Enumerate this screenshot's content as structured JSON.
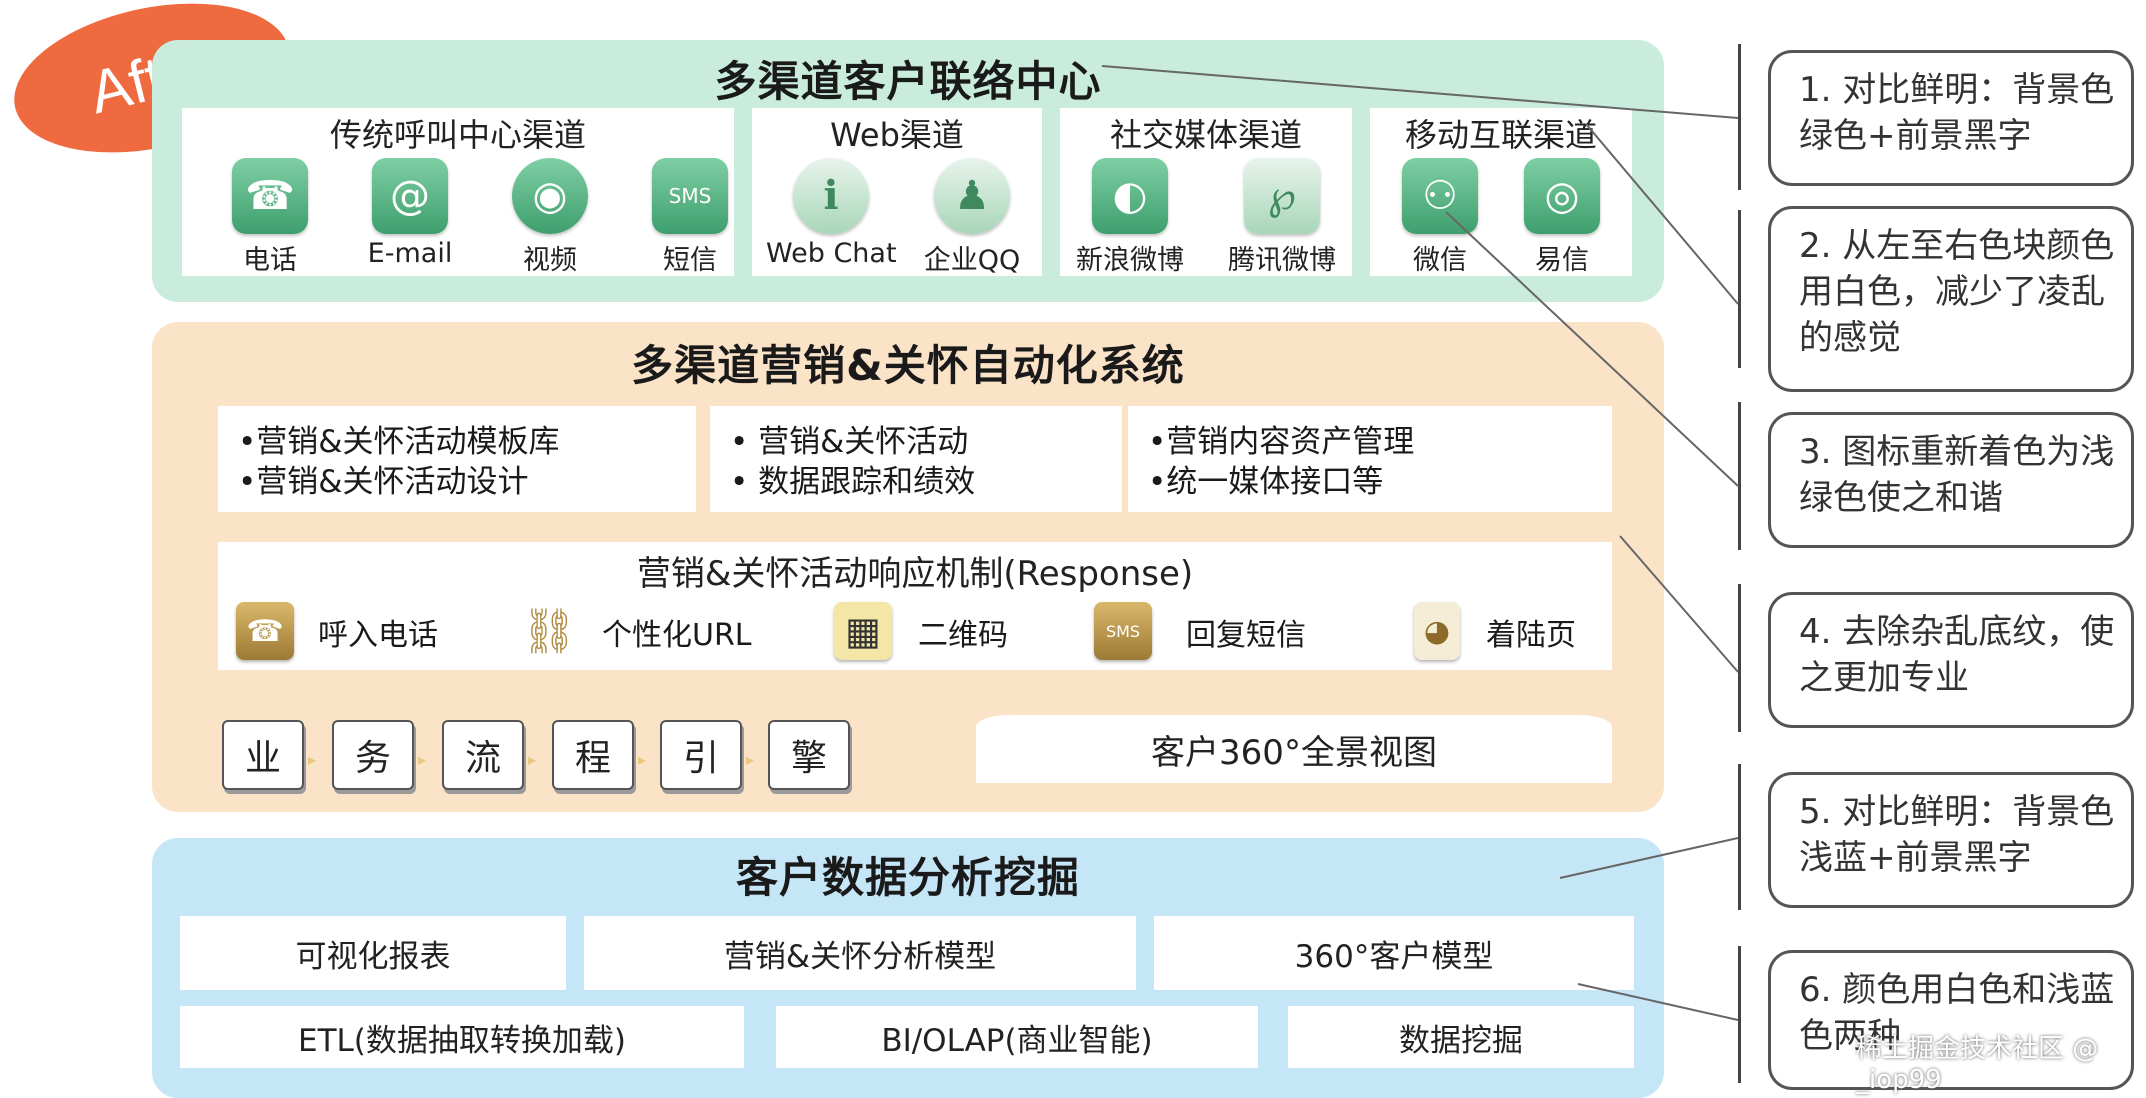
{
  "badge": "After",
  "top": {
    "title": "多渠道客户联络中心",
    "groups": [
      {
        "title": "传统呼叫中心渠道",
        "items": [
          {
            "label": "电话",
            "icon": "phone-icon"
          },
          {
            "label": "E-mail",
            "icon": "email-icon"
          },
          {
            "label": "视频",
            "icon": "webcam-icon"
          },
          {
            "label": "短信",
            "icon": "sms-icon"
          }
        ]
      },
      {
        "title": "Web渠道",
        "items": [
          {
            "label": "Web Chat",
            "icon": "chat-bubble-icon"
          },
          {
            "label": "企业QQ",
            "icon": "qq-icon"
          }
        ]
      },
      {
        "title": "社交媒体渠道",
        "items": [
          {
            "label": "新浪微博",
            "icon": "weibo-icon"
          },
          {
            "label": "腾讯微博",
            "icon": "tencent-weibo-icon"
          }
        ]
      },
      {
        "title": "移动互联渠道",
        "items": [
          {
            "label": "微信",
            "icon": "wechat-icon"
          },
          {
            "label": "易信",
            "icon": "yixin-icon"
          }
        ]
      }
    ]
  },
  "middle": {
    "title": "多渠道营销&关怀自动化系统",
    "boxes": [
      {
        "lines": [
          "•营销&关怀活动模板库",
          "•营销&关怀活动设计"
        ]
      },
      {
        "lines": [
          "•   营销&关怀活动",
          "•   数据跟踪和绩效"
        ]
      },
      {
        "lines": [
          "•营销内容资产管理",
          "•统一媒体接口等"
        ]
      }
    ],
    "response": {
      "title": "营销&关怀活动响应机制(Response)",
      "items": [
        {
          "label": "呼入电话",
          "icon": "phone-icon"
        },
        {
          "label": "个性化URL",
          "icon": "link-icon"
        },
        {
          "label": "二维码",
          "icon": "qr-code-icon"
        },
        {
          "label": "回复短信",
          "icon": "sms-icon"
        },
        {
          "label": "着陆页",
          "icon": "landing-page-icon"
        }
      ]
    },
    "engine_keys": [
      "业",
      "务",
      "流",
      "程",
      "引",
      "擎"
    ],
    "view": "客户360°全景视图"
  },
  "bottom": {
    "title": "客户数据分析挖掘",
    "row1": [
      "可视化报表",
      "营销&关怀分析模型",
      "360°客户模型"
    ],
    "row2": [
      "ETL(数据抽取转换加载)",
      "BI/OLAP(商业智能)",
      "数据挖掘"
    ]
  },
  "notes": [
    "1. 对比鲜明：背景色绿色+前景黑字",
    "2. 从左至右色块颜色用白色，减少了凌乱的感觉",
    "3. 图标重新着色为浅绿色使之和谐",
    "4. 去除杂乱底纹，使之更加专业",
    "5. 对比鲜明：背景色浅蓝+前景黑字",
    "6. 颜色用白色和浅蓝色两种"
  ],
  "watermark": "稀土掘金技术社区 @ _iop99",
  "colors": {
    "green": "#c9ecdc",
    "orange": "#fbe3c8",
    "blue": "#c4e6f6",
    "badge": "#ef6a3f"
  }
}
